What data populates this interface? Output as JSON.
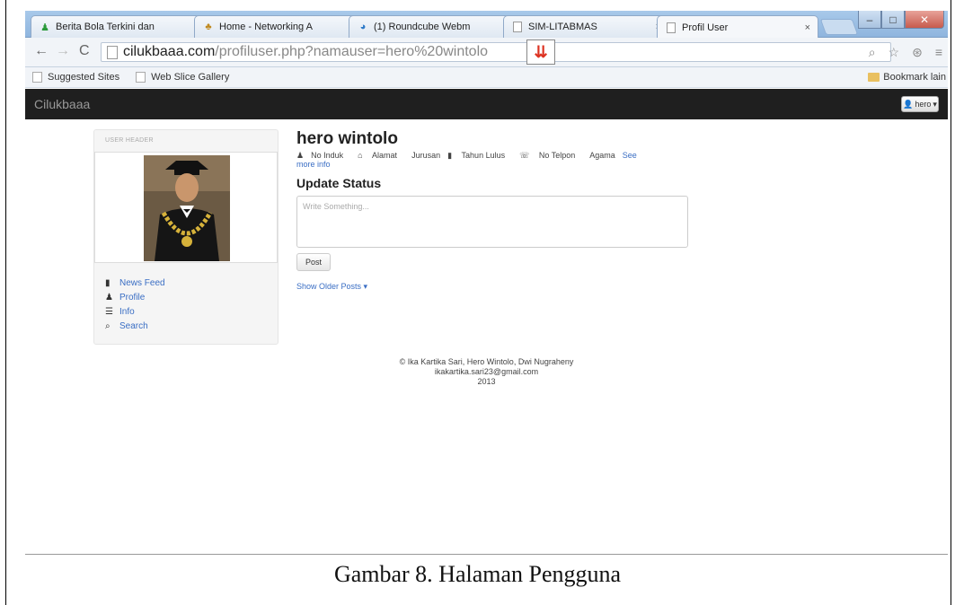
{
  "browser": {
    "tabs": [
      {
        "label": "Berita Bola Terkini dan",
        "icon": "green-tab-icon"
      },
      {
        "label": "Home - Networking A",
        "icon": "network-icon"
      },
      {
        "label": "(1) Roundcube Webm",
        "icon": "roundcube-icon"
      },
      {
        "label": "SIM-LITABMAS",
        "icon": "page-icon"
      },
      {
        "label": "Profil User",
        "icon": "page-icon"
      }
    ],
    "close_glyph": "×",
    "address": {
      "domain": "cilukbaaa.com",
      "path": "/profiluser.php?namauser=hero%20wintolo"
    },
    "bookmarks": [
      {
        "label": "Suggested Sites"
      },
      {
        "label": "Web Slice Gallery"
      }
    ],
    "bookmarks_other": "Bookmark lain"
  },
  "app": {
    "brand": "Cilukbaaa",
    "user_button": "hero"
  },
  "sidebar": {
    "header": "User Header",
    "items": [
      {
        "label": "News Feed",
        "icon": "file-icon"
      },
      {
        "label": "Profile",
        "icon": "user-icon"
      },
      {
        "label": "Info",
        "icon": "list-icon"
      },
      {
        "label": "Search",
        "icon": "search-icon"
      }
    ]
  },
  "profile": {
    "name": "hero wintolo",
    "meta": [
      "No Induk",
      "Alamat",
      "Jurusan",
      "Tahun Lulus",
      "No Telpon",
      "Agama"
    ],
    "see_more_a": "See",
    "see_more_b": "more info",
    "update_title": "Update Status",
    "placeholder": "Write Something...",
    "post_button": "Post",
    "older_posts": "Show Older Posts ▾"
  },
  "footer": {
    "line1": "© Ika Kartika Sari, Hero Wintolo, Dwi Nugraheny",
    "line2": "ikakartika.sari23@gmail.com",
    "line3": "2013"
  },
  "caption": "Gambar 8. Halaman Pengguna"
}
